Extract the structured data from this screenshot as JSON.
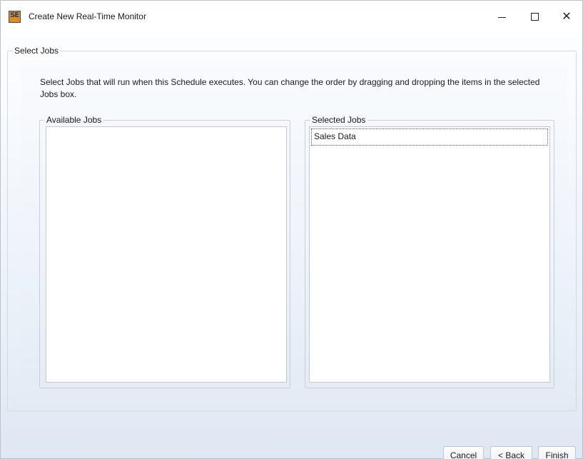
{
  "window": {
    "title": "Create New Real-Time Monitor",
    "icon_name": "app-logo-icon",
    "icon_text": "SE",
    "controls": {
      "minimize": "minimize-icon",
      "maximize": "maximize-icon",
      "close": "close-icon"
    }
  },
  "group": {
    "legend": "Select Jobs",
    "description": "Select Jobs that will run when this Schedule executes. You can change the order by dragging and dropping the items in the selected Jobs box."
  },
  "available_jobs": {
    "legend": "Available Jobs",
    "items": []
  },
  "selected_jobs": {
    "legend": "Selected Jobs",
    "items": [
      "Sales Data"
    ]
  },
  "footer": {
    "cancel_label": "Cancel",
    "back_label": "< Back",
    "finish_label": "Finish"
  },
  "colors": {
    "accent_icon": "#e38b14",
    "icon_border": "#2a4c8f",
    "panel_gradient_bottom": "#dfe7f2"
  }
}
